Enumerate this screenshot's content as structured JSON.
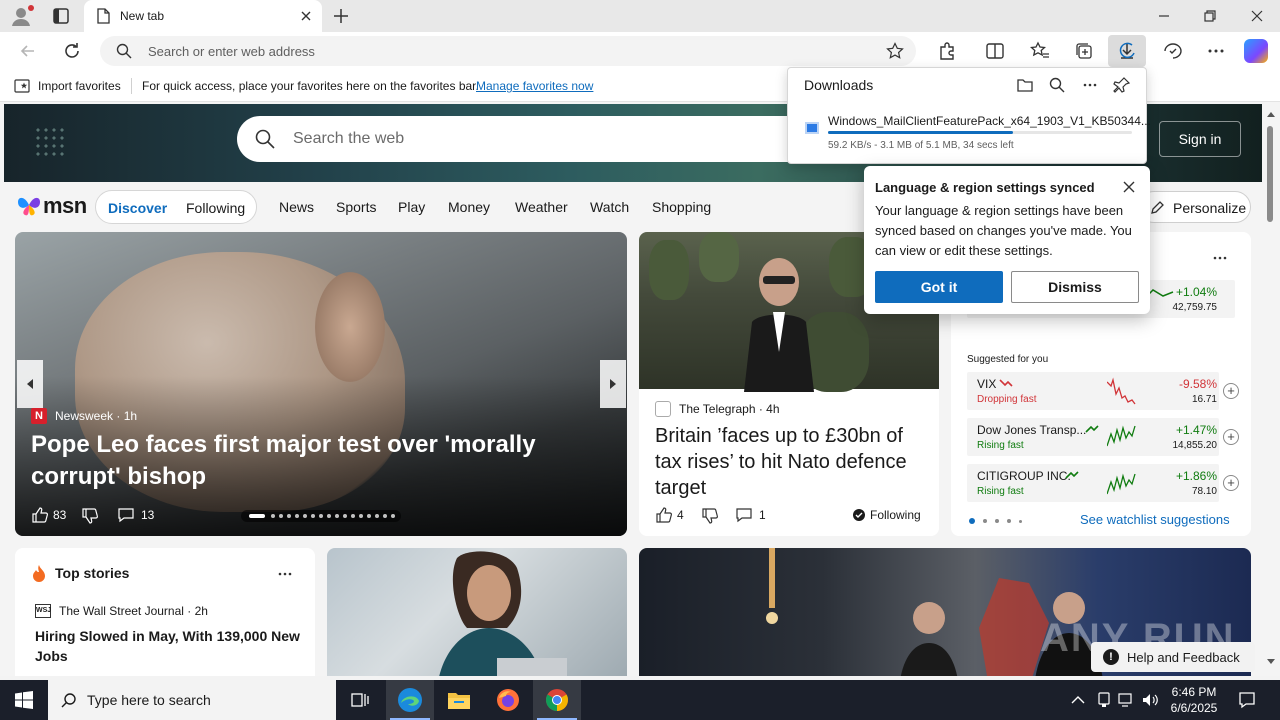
{
  "browser": {
    "tab_title": "New tab",
    "address_placeholder": "Search or enter web address"
  },
  "favorites_bar": {
    "import_label": "Import favorites",
    "hint_text": "For quick access, place your favorites here on the favorites bar.",
    "manage_link": "Manage favorites now"
  },
  "downloads": {
    "title": "Downloads",
    "file_name": "Windows_MailClientFeaturePack_x64_1903_V1_KB50344...",
    "status": "59.2 KB/s - 3.1 MB of 5.1 MB, 34 secs left",
    "progress": 0.61
  },
  "lang_popup": {
    "title": "Language & region settings synced",
    "body": "Your language & region settings have been synced based on changes you've made. You can view or edit these settings.",
    "got_it": "Got it",
    "dismiss": "Dismiss"
  },
  "msn": {
    "search_placeholder": "Search the web",
    "sign_in": "Sign in",
    "logo_text": "msn",
    "discover": "Discover",
    "following": "Following",
    "nav": [
      "News",
      "Sports",
      "Play",
      "Money",
      "Weather",
      "Watch",
      "Shopping"
    ],
    "personalize": "Personalize"
  },
  "main_story": {
    "source": "Newsweek",
    "source_logo": "N",
    "age": "1h",
    "headline": "Pope Leo faces first major test over 'morally corrupt' bishop",
    "likes": "83",
    "comments": "13"
  },
  "story2": {
    "source": "The Telegraph",
    "age": "4h",
    "headline": "Britain ’faces up to £30bn of tax rises’ to hit Nato defence target",
    "likes": "4",
    "comments": "1",
    "following": "Following"
  },
  "markets": {
    "index_change": "+1.04%",
    "index_value": "42,759.75",
    "suggested_label": "Suggested for you",
    "rows": [
      {
        "name": "VIX",
        "status": "Dropping fast",
        "change": "-9.58%",
        "value": "16.71",
        "color": "#d13438"
      },
      {
        "name": "Dow Jones Transp...",
        "status": "Rising fast",
        "change": "+1.47%",
        "value": "14,855.20",
        "color": "#107c10"
      },
      {
        "name": "CITIGROUP INC.",
        "status": "Rising fast",
        "change": "+1.86%",
        "value": "78.10",
        "color": "#107c10"
      }
    ],
    "watchlist_link": "See watchlist suggestions"
  },
  "top_stories": {
    "title": "Top stories",
    "source": "The Wall Street Journal",
    "source_logo": "WSJ",
    "age": "2h",
    "headline": "Hiring Slowed in May, With 139,000 New Jobs"
  },
  "help": {
    "label": "Help and Feedback"
  },
  "watermark": "ANY RUN",
  "taskbar": {
    "search_placeholder": "Type here to search",
    "time": "6:46 PM",
    "date": "6/6/2025"
  },
  "colors": {
    "accent": "#0f6cbd",
    "negative": "#d13438",
    "positive": "#107c10"
  }
}
